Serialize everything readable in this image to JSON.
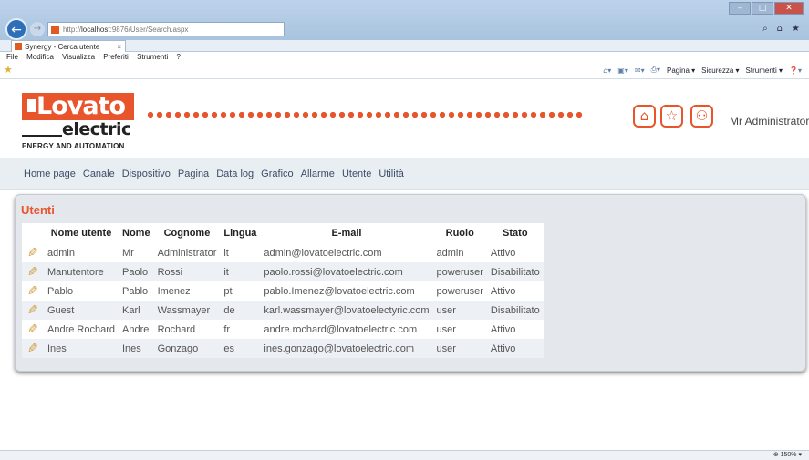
{
  "browser": {
    "address": {
      "prefix": "http://",
      "host": "localhost",
      "path": ":9876/User/Search.aspx"
    },
    "tab_title": "Synergy - Cerca utente",
    "tab_close": "×",
    "menu": [
      "File",
      "Modifica",
      "Visualizza",
      "Preferiti",
      "Strumenti",
      "?"
    ],
    "commands": [
      "Pagina ▾",
      "Sicurezza ▾",
      "Strumenti ▾"
    ],
    "zoom": "150%"
  },
  "header": {
    "logo_top": "Lovato",
    "logo_bottom": "electric",
    "tagline": "ENERGY AND AUTOMATION",
    "user_name": "Mr Administrator"
  },
  "nav": [
    "Home page",
    "Canale",
    "Dispositivo",
    "Pagina",
    "Data log",
    "Grafico",
    "Allarme",
    "Utente",
    "Utilità"
  ],
  "panel": {
    "title": "Utenti",
    "columns": [
      "Nome utente",
      "Nome",
      "Cognome",
      "Lingua",
      "E-mail",
      "Ruolo",
      "Stato"
    ],
    "rows": [
      [
        "admin",
        "Mr",
        "Administrator",
        "it",
        "admin@lovatoelectric.com",
        "admin",
        "Attivo"
      ],
      [
        "Manutentore",
        "Paolo",
        "Rossi",
        "it",
        "paolo.rossi@lovatoelectric.com",
        "poweruser",
        "Disabilitato"
      ],
      [
        "Pablo",
        "Pablo",
        "Imenez",
        "pt",
        "pablo.Imenez@lovatoelectric.com",
        "poweruser",
        "Attivo"
      ],
      [
        "Guest",
        "Karl",
        "Wassmayer",
        "de",
        "karl.wassmayer@lovatoelectyric.com",
        "user",
        "Disabilitato"
      ],
      [
        "Andre Rochard",
        "Andre",
        "Rochard",
        "fr",
        "andre.rochard@lovatoelectric.com",
        "user",
        "Attivo"
      ],
      [
        "Ines",
        "Ines",
        "Gonzago",
        "es",
        "ines.gonzago@lovatoelectric.com",
        "user",
        "Attivo"
      ]
    ]
  },
  "colors": {
    "accent": "#e8542b",
    "nav_bg": "#e9eef3",
    "panel_bg": "#e4e8ec"
  },
  "icons": [
    "back-arrow-icon",
    "forward-arrow-icon",
    "home-icon",
    "star-icon",
    "user-icon",
    "pencil-edit-icon"
  ]
}
